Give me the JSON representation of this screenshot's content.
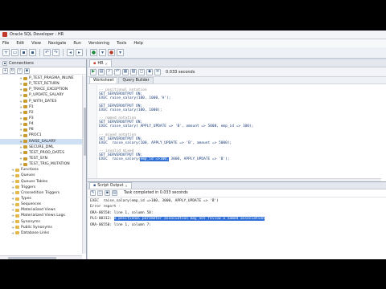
{
  "window": {
    "title": "Oracle SQL Developer : HR"
  },
  "menu": [
    "File",
    "Edit",
    "View",
    "Navigate",
    "Run",
    "Versioning",
    "Tools",
    "Help"
  ],
  "left_panel": {
    "tab_label": "Connections",
    "tree": [
      {
        "label": "P_TEST_PRAGMA_INLINE",
        "kind": "proc",
        "expand": "+"
      },
      {
        "label": "P_TEST_RETURN",
        "kind": "proc",
        "expand": "+"
      },
      {
        "label": "P_TRACE_EXCEPTION",
        "kind": "proc",
        "expand": "+"
      },
      {
        "label": "P_UPDATE_SALARY",
        "kind": "proc",
        "expand": "+"
      },
      {
        "label": "P_WITH_DATES",
        "kind": "proc",
        "expand": "+"
      },
      {
        "label": "P1",
        "kind": "proc",
        "expand": "+"
      },
      {
        "label": "P2",
        "kind": "proc",
        "expand": "+"
      },
      {
        "label": "P3",
        "kind": "proc",
        "expand": "+"
      },
      {
        "label": "P4",
        "kind": "proc",
        "expand": "+"
      },
      {
        "label": "P8",
        "kind": "proc",
        "expand": "+"
      },
      {
        "label": "PROC1",
        "kind": "proc",
        "expand": "+"
      },
      {
        "label": "RAISE_SALARY",
        "kind": "proc",
        "expand": "+",
        "selected": true
      },
      {
        "label": "SECURE_DML",
        "kind": "proc",
        "expand": "+"
      },
      {
        "label": "TEST_PROD_DATES",
        "kind": "proc",
        "expand": "+"
      },
      {
        "label": "TEST_SYN",
        "kind": "proc",
        "expand": "+"
      },
      {
        "label": "TEST_TRIG_MUTATION",
        "kind": "proc",
        "expand": "+"
      },
      {
        "label": "Functions",
        "kind": "folder",
        "expand": "+"
      },
      {
        "label": "Queues",
        "kind": "folder",
        "expand": "+"
      },
      {
        "label": "Queues Tables",
        "kind": "folder",
        "expand": "+"
      },
      {
        "label": "Triggers",
        "kind": "folder",
        "expand": "+"
      },
      {
        "label": "Crossedition Triggers",
        "kind": "folder",
        "expand": "+"
      },
      {
        "label": "Types",
        "kind": "folder",
        "expand": "+"
      },
      {
        "label": "Sequences",
        "kind": "folder",
        "expand": "+"
      },
      {
        "label": "Materialized Views",
        "kind": "folder",
        "expand": "+"
      },
      {
        "label": "Materialized Views Logs",
        "kind": "folder",
        "expand": "+"
      },
      {
        "label": "Synonyms",
        "kind": "folder",
        "expand": "+"
      },
      {
        "label": "Public Synonyms",
        "kind": "folder",
        "expand": "+"
      },
      {
        "label": "Database Links",
        "kind": "folder",
        "expand": "+"
      }
    ]
  },
  "editor": {
    "tab_label": "HR",
    "exec_time": "0.033 seconds",
    "sub_tabs": [
      "Worksheet",
      "Query Builder"
    ],
    "lines": [
      {
        "text": "-- positional notation",
        "style": "comment"
      },
      {
        "text": "SET SERVEROUTPUT ON;",
        "style": "kw"
      },
      {
        "text": "EXEC raise_salary(100, 1000,'A');",
        "style": "kw"
      },
      {
        "text": "",
        "style": "kw"
      },
      {
        "text": "SET SERVEROUTPUT ON;",
        "style": "kw"
      },
      {
        "text": "EXEC raise_salary(100, 1000);",
        "style": "kw"
      },
      {
        "text": "",
        "style": "kw"
      },
      {
        "text": "-- named notation",
        "style": "comment"
      },
      {
        "text": "SET SERVEROUTPUT ON;",
        "style": "kw"
      },
      {
        "text": "EXEC raise_salary( APPLY_UPDATE => 'B', amount => 5000, emp_id => 100);",
        "style": "kw"
      },
      {
        "text": "",
        "style": "kw"
      },
      {
        "text": "-- mixed notation",
        "style": "comment"
      },
      {
        "text": "SET SERVEROUTPUT ON;",
        "style": "kw"
      },
      {
        "text": "EXEC  raise_salary(100, APPLY_UPDATE => 'B', amount => 5000);",
        "style": "kw"
      },
      {
        "text": "",
        "style": "kw"
      },
      {
        "text": "-- invalid mixed",
        "style": "comment"
      },
      {
        "text": "SET SERVEROUTPUT ON;",
        "style": "kw"
      },
      {
        "text": "EXEC  raise_salary(",
        "style": "kw",
        "hl": "emp_id =>100,",
        "after": " 3000, APPLY_UPDATE => 'B');"
      }
    ]
  },
  "output": {
    "tab_label": "Script Output",
    "task_status": "Task completed in 0.033 seconds",
    "lines": [
      {
        "text": "EXEC  raise_salary(emp_id =>100, 3000, APPLY_UPDATE => 'B')"
      },
      {
        "text": "Error report -"
      },
      {
        "text": "ORA-06550: line 1, column 50:"
      },
      {
        "text": "PLS-00312: ",
        "sel": "a positional parameter association may not follow a named association"
      },
      {
        "text": "ORA-06550: line 1, column 7:"
      }
    ]
  }
}
